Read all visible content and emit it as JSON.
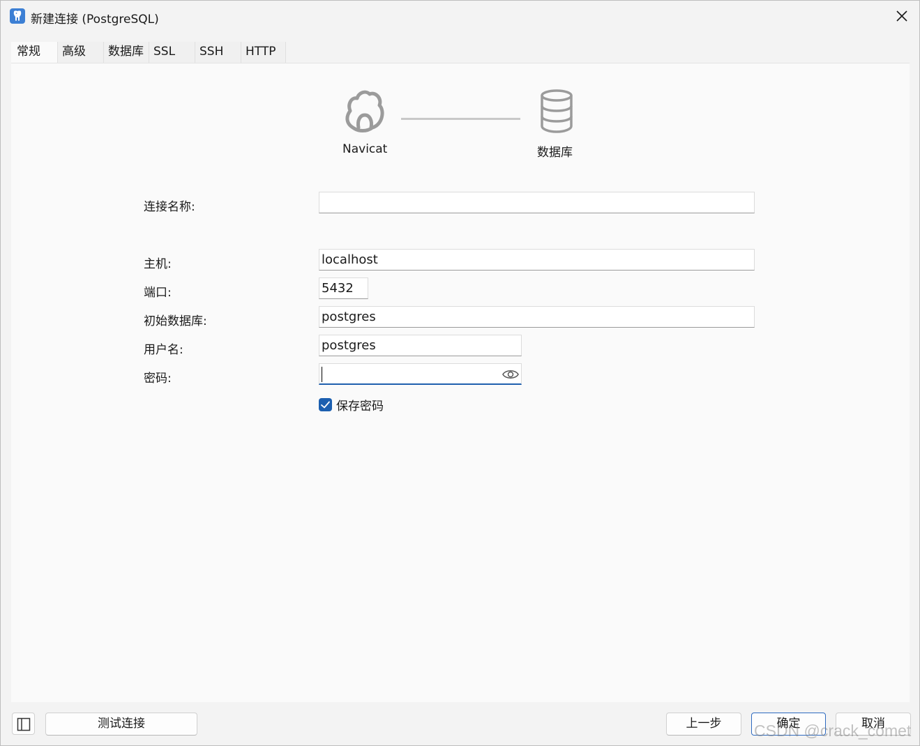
{
  "window": {
    "title": "新建连接 (PostgreSQL)",
    "app_icon": "postgresql-elephant-icon",
    "close_icon": "close-icon"
  },
  "tabs": [
    {
      "label": "常规",
      "active": true
    },
    {
      "label": "高级",
      "active": false
    },
    {
      "label": "数据库",
      "active": false
    },
    {
      "label": "SSL",
      "active": false
    },
    {
      "label": "SSH",
      "active": false
    },
    {
      "label": "HTTP",
      "active": false
    }
  ],
  "diagram": {
    "left_label": "Navicat",
    "right_label": "数据库",
    "left_icon": "navicat-logo-icon",
    "right_icon": "database-icon"
  },
  "form": {
    "connection_name": {
      "label": "连接名称:",
      "value": ""
    },
    "host": {
      "label": "主机:",
      "value": "localhost"
    },
    "port": {
      "label": "端口:",
      "value": "5432"
    },
    "initial_db": {
      "label": "初始数据库:",
      "value": "postgres"
    },
    "username": {
      "label": "用户名:",
      "value": "postgres"
    },
    "password": {
      "label": "密码:",
      "value": ""
    },
    "save_password": {
      "label": "保存密码",
      "checked": true
    }
  },
  "buttons": {
    "test": "测试连接",
    "prev": "上一步",
    "ok": "确定",
    "cancel": "取消"
  },
  "watermark": "CSDN @crack_comet",
  "colors": {
    "accent": "#1c5fb0",
    "window_bg": "#f3f3f3",
    "panel_bg": "#fafafa"
  }
}
